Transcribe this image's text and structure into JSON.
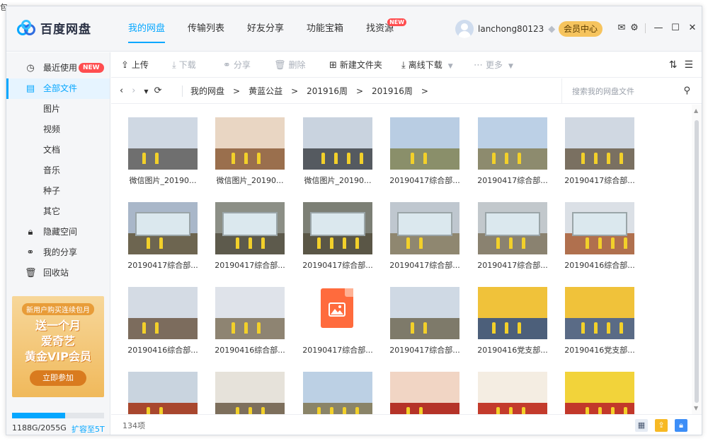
{
  "edge_text": "包",
  "app": {
    "logo_text": "百度网盘",
    "nav": [
      {
        "label": "我的网盘",
        "active": true
      },
      {
        "label": "传输列表"
      },
      {
        "label": "好友分享"
      },
      {
        "label": "功能宝箱"
      },
      {
        "label": "找资源",
        "badge": "NEW"
      }
    ],
    "username": "lanchong80123",
    "vip_button": "会员中心"
  },
  "sidebar": {
    "items": [
      {
        "label": "最近使用",
        "icon": "clock-icon",
        "badge": "NEW"
      },
      {
        "label": "全部文件",
        "icon": "document-icon",
        "active": true
      },
      {
        "label": "图片"
      },
      {
        "label": "视频"
      },
      {
        "label": "文档"
      },
      {
        "label": "音乐"
      },
      {
        "label": "种子"
      },
      {
        "label": "其它"
      },
      {
        "label": "隐藏空间",
        "icon": "lock-icon"
      },
      {
        "label": "我的分享",
        "icon": "share-icon"
      },
      {
        "label": "回收站",
        "icon": "trash-icon"
      }
    ],
    "promo": {
      "top": "新用户购买连续包月",
      "line1": "送一个月",
      "line2": "爱奇艺",
      "line3": "黄金VIP会员",
      "button": "立即参加"
    },
    "storage": {
      "text": "1188G/2055G",
      "used_fraction": 0.578,
      "expand": "扩容至5T"
    }
  },
  "toolbar": {
    "upload": "上传",
    "download": "下载",
    "share": "分享",
    "delete": "删除",
    "new_folder": "新建文件夹",
    "offline_download": "离线下载",
    "more": "更多"
  },
  "breadcrumb": [
    "我的网盘",
    "黄蓝公益",
    "201916周",
    "201916周"
  ],
  "search": {
    "placeholder": "搜索我的网盘文件"
  },
  "files": [
    "微信图片_20190...",
    "微信图片_20190...",
    "微信图片_20190...",
    "20190417综合部...",
    "20190417综合部...",
    "20190417综合部...",
    "20190417综合部...",
    "20190417综合部...",
    "20190417综合部...",
    "20190417综合部...",
    "20190417综合部...",
    "20190416综合部...",
    "20190416综合部...",
    "20190416综合部...",
    "20190417综合部...",
    "20190417综合部...",
    "20190416党支部...",
    "20190416党支部...",
    "",
    "",
    "",
    "",
    "",
    ""
  ],
  "status": {
    "count": "134项"
  },
  "colors": {
    "accent": "#06a7ff",
    "vip": "#f6c45e",
    "badge": "#ff4d4f"
  }
}
